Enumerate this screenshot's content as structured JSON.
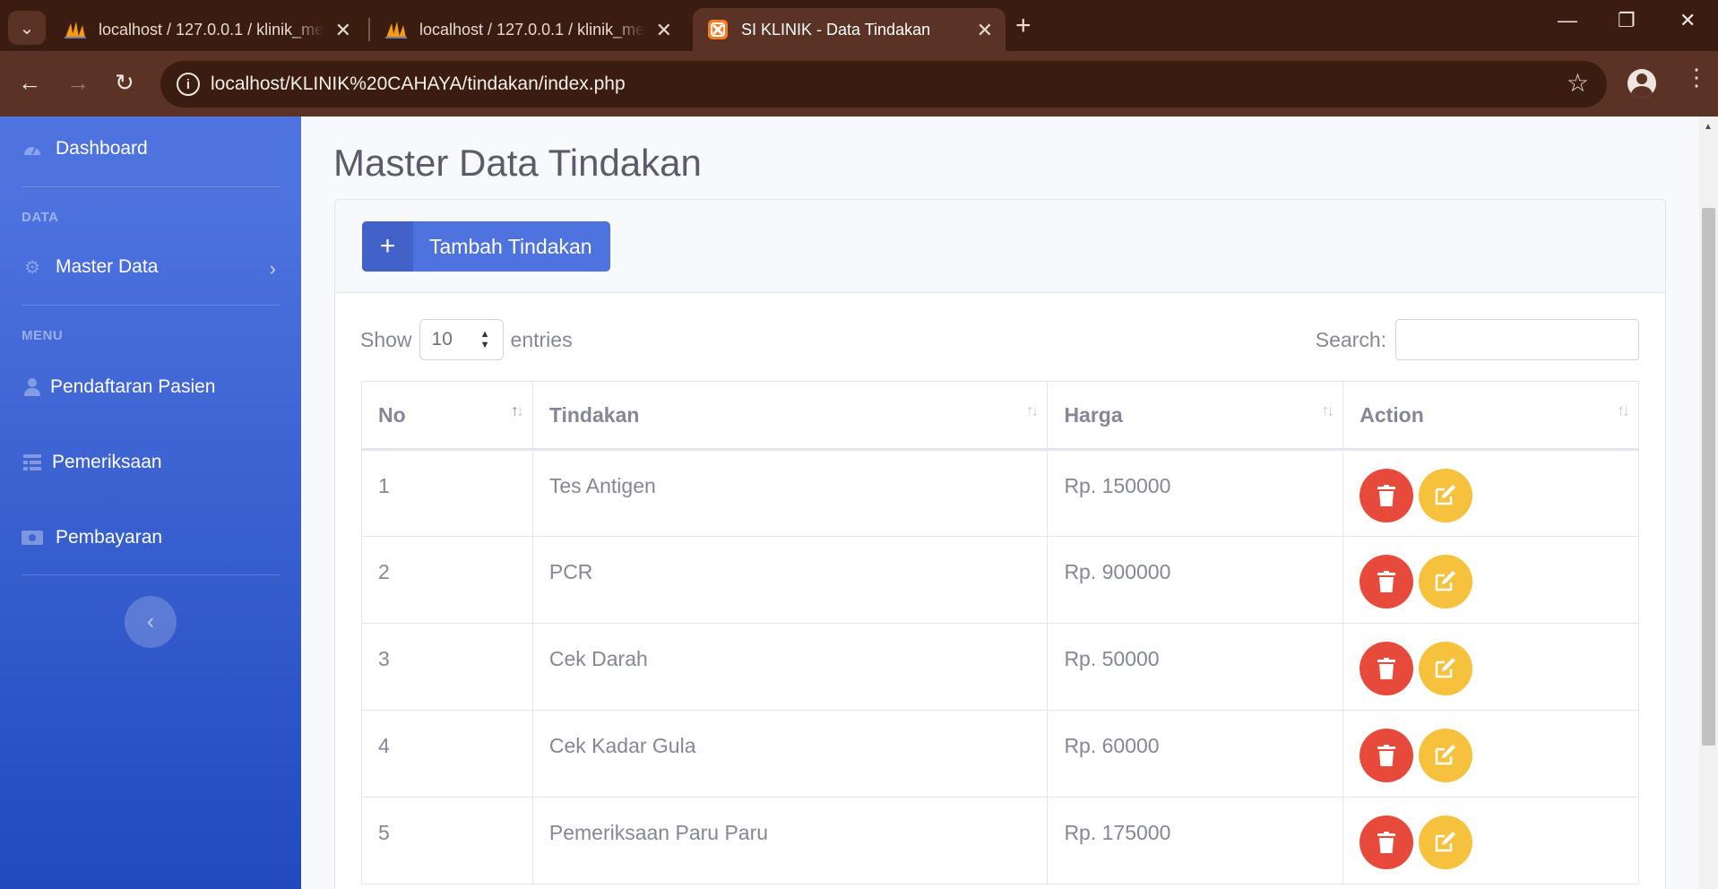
{
  "browser": {
    "tabs": [
      {
        "title": "localhost / 127.0.0.1 / klinik_medika",
        "icon": "phpmyadmin-icon",
        "active": false
      },
      {
        "title": "localhost / 127.0.0.1 / klinik_medika",
        "icon": "phpmyadmin-icon",
        "active": false
      },
      {
        "title": "SI KLINIK - Data Tindakan",
        "icon": "xampp-icon",
        "active": true
      }
    ],
    "url": "localhost/KLINIK%20CAHAYA/tindakan/index.php",
    "colors": {
      "frame": "#3a1c10",
      "toolbar": "#5a3324"
    }
  },
  "sidebar": {
    "dashboard": {
      "label": "Dashboard",
      "icon": "tachometer-icon"
    },
    "heading_data": "DATA",
    "master_data": {
      "label": "Master Data",
      "icon": "cog-icon"
    },
    "heading_menu": "MENU",
    "pendaftaran": {
      "label": "Pendaftaran Pasien",
      "icon": "user-icon"
    },
    "pemeriksaan": {
      "label": "Pemeriksaan",
      "icon": "table-icon"
    },
    "pembayaran": {
      "label": "Pembayaran",
      "icon": "money-icon"
    },
    "colors": {
      "gradient_start": "#4e73df",
      "gradient_end": "#224abe"
    }
  },
  "main": {
    "page_title": "Master Data Tindakan",
    "add_button": "Tambah Tindakan",
    "length": {
      "show": "Show",
      "value": "10",
      "entries": "entries"
    },
    "search_label": "Search:",
    "search_value": "",
    "columns": [
      "No",
      "Tindakan",
      "Harga",
      "Action"
    ],
    "rows": [
      {
        "no": "1",
        "tindakan": "Tes Antigen",
        "harga": "Rp. 150000"
      },
      {
        "no": "2",
        "tindakan": "PCR",
        "harga": "Rp. 900000"
      },
      {
        "no": "3",
        "tindakan": "Cek Darah",
        "harga": "Rp. 50000"
      },
      {
        "no": "4",
        "tindakan": "Cek Kadar Gula",
        "harga": "Rp. 60000"
      },
      {
        "no": "5",
        "tindakan": "Pemeriksaan Paru Paru",
        "harga": "Rp. 175000"
      }
    ],
    "colors": {
      "primary": "#4e73df",
      "danger": "#e74a3b",
      "warning": "#f6c23e",
      "text": "#858796"
    }
  }
}
